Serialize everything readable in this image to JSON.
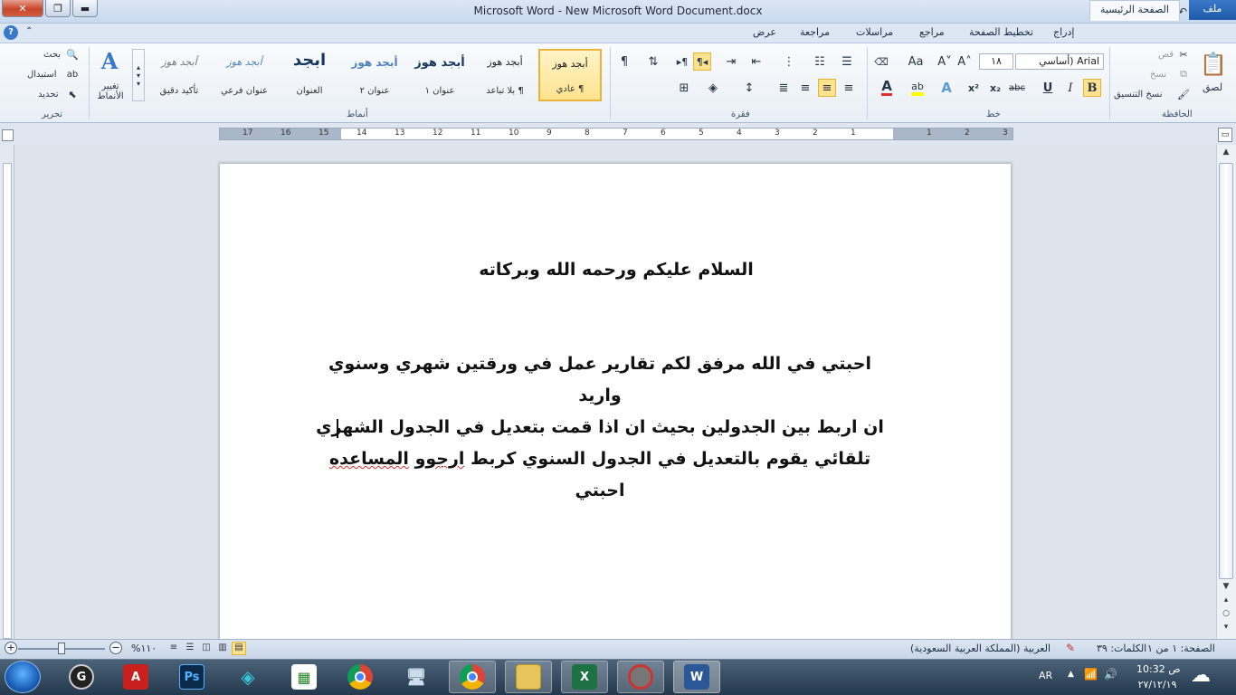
{
  "window": {
    "title": "Microsoft Word  -  New Microsoft Word Document.docx",
    "close_glyph": "✕",
    "max_glyph": "❐",
    "min_glyph": "▬",
    "qat_save_glyph": "💾",
    "qat_undo_glyph": "↶",
    "qat_redo_glyph": "↻",
    "qat_customize_glyph": "▾",
    "qat_app_glyph": "W"
  },
  "tabs": {
    "file": "ملف",
    "home": "الصفحة الرئيسية",
    "insert": "إدراج",
    "layout": "تخطيط الصفحة",
    "references": "مراجع",
    "mailings": "مراسلات",
    "review": "مراجعة",
    "view": "عرض",
    "help_glyph": "?",
    "collapse_glyph": "⌃"
  },
  "ribbon": {
    "clipboard": {
      "label": "الحافظة",
      "paste": "لصق",
      "cut": "قص",
      "copy": "نسخ",
      "format_painter": "نسخ التنسيق"
    },
    "font": {
      "label": "خط",
      "font_name": "Arial (أساسي",
      "font_size": "١٨",
      "bold": "B",
      "italic": "I",
      "underline": "U",
      "strike": "abc",
      "subscript": "x₂",
      "superscript": "x²",
      "grow": "A˄",
      "shrink": "A˅",
      "change_case": "Aa"
    },
    "paragraph": {
      "label": "فقرة"
    },
    "styles": {
      "label": "أنماط",
      "items": [
        {
          "sample": "أبجد هوز",
          "name": "¶ عادي"
        },
        {
          "sample": "أبجد هوز",
          "name": "¶ بلا تباعد"
        },
        {
          "sample": "أبجد هوز",
          "name": "عنوان ١"
        },
        {
          "sample": "أبجد هوز",
          "name": "عنوان ٢"
        },
        {
          "sample": "ابجد",
          "name": "العنوان"
        },
        {
          "sample": "أبجد هوز",
          "name": "عنوان فرعي"
        },
        {
          "sample": "أبجد هوز",
          "name": "تأكيد دقيق"
        }
      ],
      "change_styles": "تغيير الأنماط"
    },
    "editing": {
      "label": "تحرير",
      "find": "بحث",
      "replace": "استبدال",
      "select": "تحديد"
    }
  },
  "ruler": {
    "numbers": [
      "3",
      "2",
      "1",
      "",
      "1",
      "2",
      "3",
      "4",
      "5",
      "6",
      "7",
      "8",
      "9",
      "10",
      "11",
      "12",
      "13",
      "14",
      "15",
      "16",
      "17"
    ]
  },
  "document": {
    "greeting": "السلام عليكم ورحمه الله وبركاته",
    "paragraph_lines": [
      "احبتي في الله مرفق لكم تقارير عمل في ورقتين شهري وسنوي واريد",
      "ان اربط بين الجدولين بحيث ان اذا قمت بتعديل في الجدول الشهري"
    ],
    "line3_part1": "تلقائي يقوم بالتعديل في الجدول السنوي كربط ",
    "line3_misspelled1": "ارجوو",
    "line3_space": " ",
    "line3_misspelled2": "المساعده",
    "line3_part2": " احبتي"
  },
  "statusbar": {
    "page": "الصفحة: ١ من ١",
    "words": "الكلمات: ٣٩",
    "language": "العربية (المملكة العربية السعودية)",
    "zoom": "١١٠%"
  },
  "taskbar": {
    "language": "AR",
    "time": "10:32 ص",
    "date": "٢٧/١٢/١٩"
  }
}
